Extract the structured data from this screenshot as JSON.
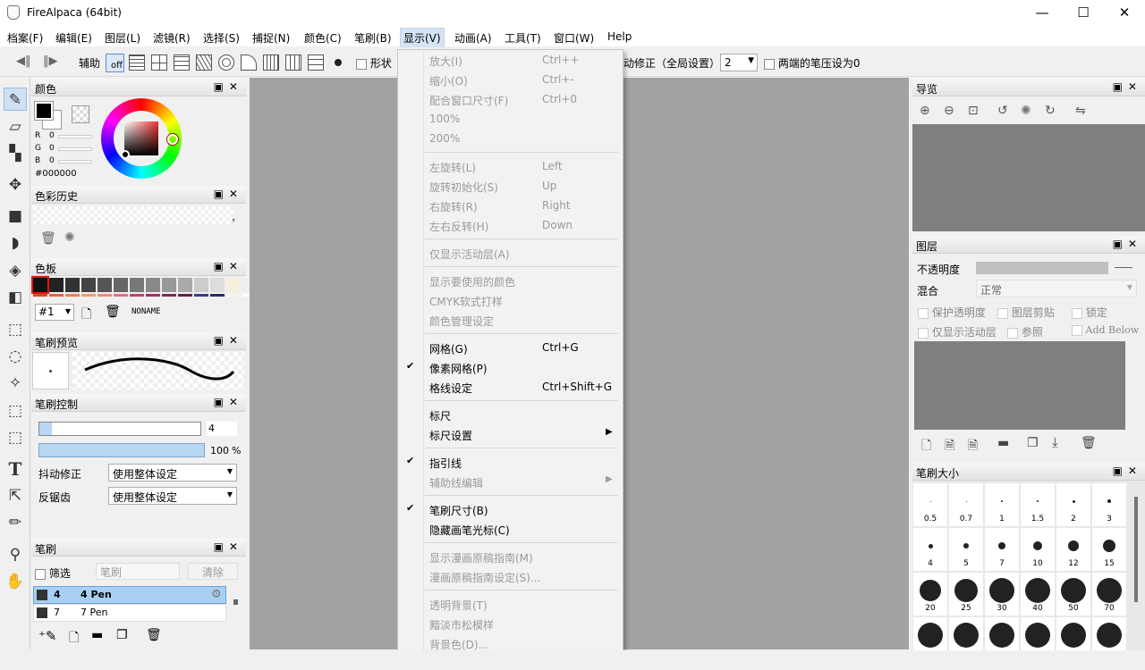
{
  "window": {
    "title": "FireAlpaca (64bit)",
    "minimize": "—",
    "maximize": "☐",
    "close": "✕"
  },
  "menubar": [
    "档案(F)",
    "编辑(E)",
    "图层(L)",
    "滤镜(R)",
    "选择(S)",
    "捕捉(N)",
    "颜色(C)",
    "笔刷(B)",
    "显示(V)",
    "动画(A)",
    "工具(T)",
    "窗口(W)",
    "Help"
  ],
  "toolbar": {
    "assist_label": "辅助",
    "off_label": "off",
    "shape_label": "形状",
    "stabilizer_label": "动修正（全局设置）",
    "stabilizer_value": "2",
    "zero_pressure_label": "两端的笔压设为0"
  },
  "view_menu": {
    "groups": [
      [
        {
          "label": "放大(I)",
          "shortcut": "Ctrl++",
          "disabled": true
        },
        {
          "label": "缩小(O)",
          "shortcut": "Ctrl+-",
          "disabled": true
        },
        {
          "label": "配合窗口尺寸(F)",
          "shortcut": "Ctrl+0",
          "disabled": true
        },
        {
          "label": "100%",
          "shortcut": "",
          "disabled": true
        },
        {
          "label": "200%",
          "shortcut": "",
          "disabled": true
        }
      ],
      [
        {
          "label": "左旋转(L)",
          "shortcut": "Left",
          "disabled": true
        },
        {
          "label": "旋转初始化(S)",
          "shortcut": "Up",
          "disabled": true
        },
        {
          "label": "右旋转(R)",
          "shortcut": "Right",
          "disabled": true
        },
        {
          "label": "左右反转(H)",
          "shortcut": "Down",
          "disabled": true
        }
      ],
      [
        {
          "label": "仅显示活动层(A)",
          "shortcut": "",
          "disabled": true
        }
      ],
      [
        {
          "label": "显示要使用的颜色",
          "shortcut": "",
          "disabled": true
        },
        {
          "label": "CMYK软式打样",
          "shortcut": "",
          "disabled": true
        },
        {
          "label": "颜色管理设定",
          "shortcut": "",
          "disabled": true
        }
      ],
      [
        {
          "label": "网格(G)",
          "shortcut": "Ctrl+G",
          "disabled": false
        },
        {
          "label": "像素网格(P)",
          "shortcut": "",
          "disabled": false,
          "checked": true
        },
        {
          "label": "格线设定",
          "shortcut": "Ctrl+Shift+G",
          "disabled": false
        }
      ],
      [
        {
          "label": "标尺",
          "shortcut": "",
          "disabled": false
        },
        {
          "label": "标尺设置",
          "shortcut": "",
          "disabled": false,
          "submenu": true
        }
      ],
      [
        {
          "label": "指引线",
          "shortcut": "",
          "disabled": false,
          "checked": true
        },
        {
          "label": "辅助线编辑",
          "shortcut": "",
          "disabled": true,
          "submenu": true
        }
      ],
      [
        {
          "label": "笔刷尺寸(B)",
          "shortcut": "",
          "disabled": false,
          "checked": true
        },
        {
          "label": "隐藏画笔光标(C)",
          "shortcut": "",
          "disabled": false
        }
      ],
      [
        {
          "label": "显示漫画原稿指南(M)",
          "shortcut": "",
          "disabled": true
        },
        {
          "label": "漫画原稿指南设定(S)...",
          "shortcut": "",
          "disabled": true
        }
      ],
      [
        {
          "label": "透明背景(T)",
          "shortcut": "",
          "disabled": true
        },
        {
          "label": "黯淡市松模样",
          "shortcut": "",
          "disabled": true
        },
        {
          "label": "背景色(D)...",
          "shortcut": "",
          "disabled": true
        }
      ]
    ]
  },
  "color_panel": {
    "title": "颜色",
    "r_label": "R",
    "g_label": "G",
    "b_label": "B",
    "r": "0",
    "g": "0",
    "b": "0",
    "hex": "#000000"
  },
  "color_history": {
    "title": "色彩历史"
  },
  "palette": {
    "title": "色板",
    "index": "#1",
    "name": "NONAME",
    "colors": [
      "#111111",
      "#222222",
      "#333333",
      "#444444",
      "#555555",
      "#666666",
      "#777777",
      "#888888",
      "#999999",
      "#aaaaaa",
      "#cccccc",
      "#dddddd",
      "#f5f0dc",
      "#eeeeee"
    ]
  },
  "brush_preview": {
    "title": "笔刷预览"
  },
  "brush_control": {
    "title": "笔刷控制",
    "size": "4",
    "opacity": "100",
    "opacity_unit": "%",
    "stabilizer_label": "抖动修正",
    "stabilizer_value": "使用整体设定",
    "antialias_label": "反锯齿",
    "antialias_value": "使用整体设定"
  },
  "brush_panel": {
    "title": "笔刷",
    "filter_label": "筛选",
    "search_placeholder": "笔刷",
    "clear_label": "清除",
    "items": [
      {
        "size": "4",
        "name": "4 Pen"
      },
      {
        "size": "7",
        "name": "7 Pen"
      }
    ]
  },
  "navigator": {
    "title": "导览"
  },
  "layers": {
    "title": "图层",
    "opacity_label": "不透明度",
    "blend_label": "混合",
    "blend_value": "正常",
    "protect_alpha": "保护透明度",
    "clipping": "图层剪贴",
    "lock": "锁定",
    "show_active": "仅显示活动层",
    "reference": "参照",
    "add_below": "Add Below"
  },
  "brush_size": {
    "title": "笔刷大小",
    "sizes": [
      "0.5",
      "0.7",
      "1",
      "1.5",
      "2",
      "3",
      "4",
      "5",
      "7",
      "10",
      "12",
      "15",
      "20",
      "25",
      "30",
      "40",
      "50",
      "70",
      "",
      "",
      "",
      "",
      "",
      ""
    ]
  }
}
